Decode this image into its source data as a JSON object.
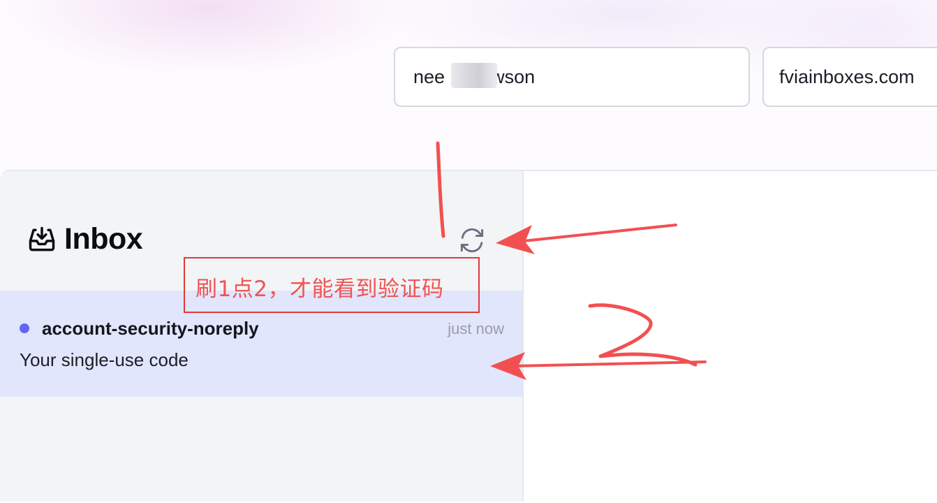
{
  "form": {
    "username_value": "nee    elawson",
    "domain_value": "fviainboxes.com"
  },
  "inbox": {
    "title": "Inbox",
    "icon": "inbox-download-icon",
    "refresh_icon": "refresh-icon"
  },
  "messages": [
    {
      "sender": "account-security-noreply",
      "time": "just now",
      "subject": "Your single-use code",
      "unread": true
    }
  ],
  "annotation": {
    "text": "刷1点2，才能看到验证码",
    "number_label": "2",
    "color": "#f05454"
  },
  "colors": {
    "accent_dot": "#6366f1",
    "selected_row": "#e1e6fc",
    "sidebar_bg": "#f3f4f6"
  }
}
